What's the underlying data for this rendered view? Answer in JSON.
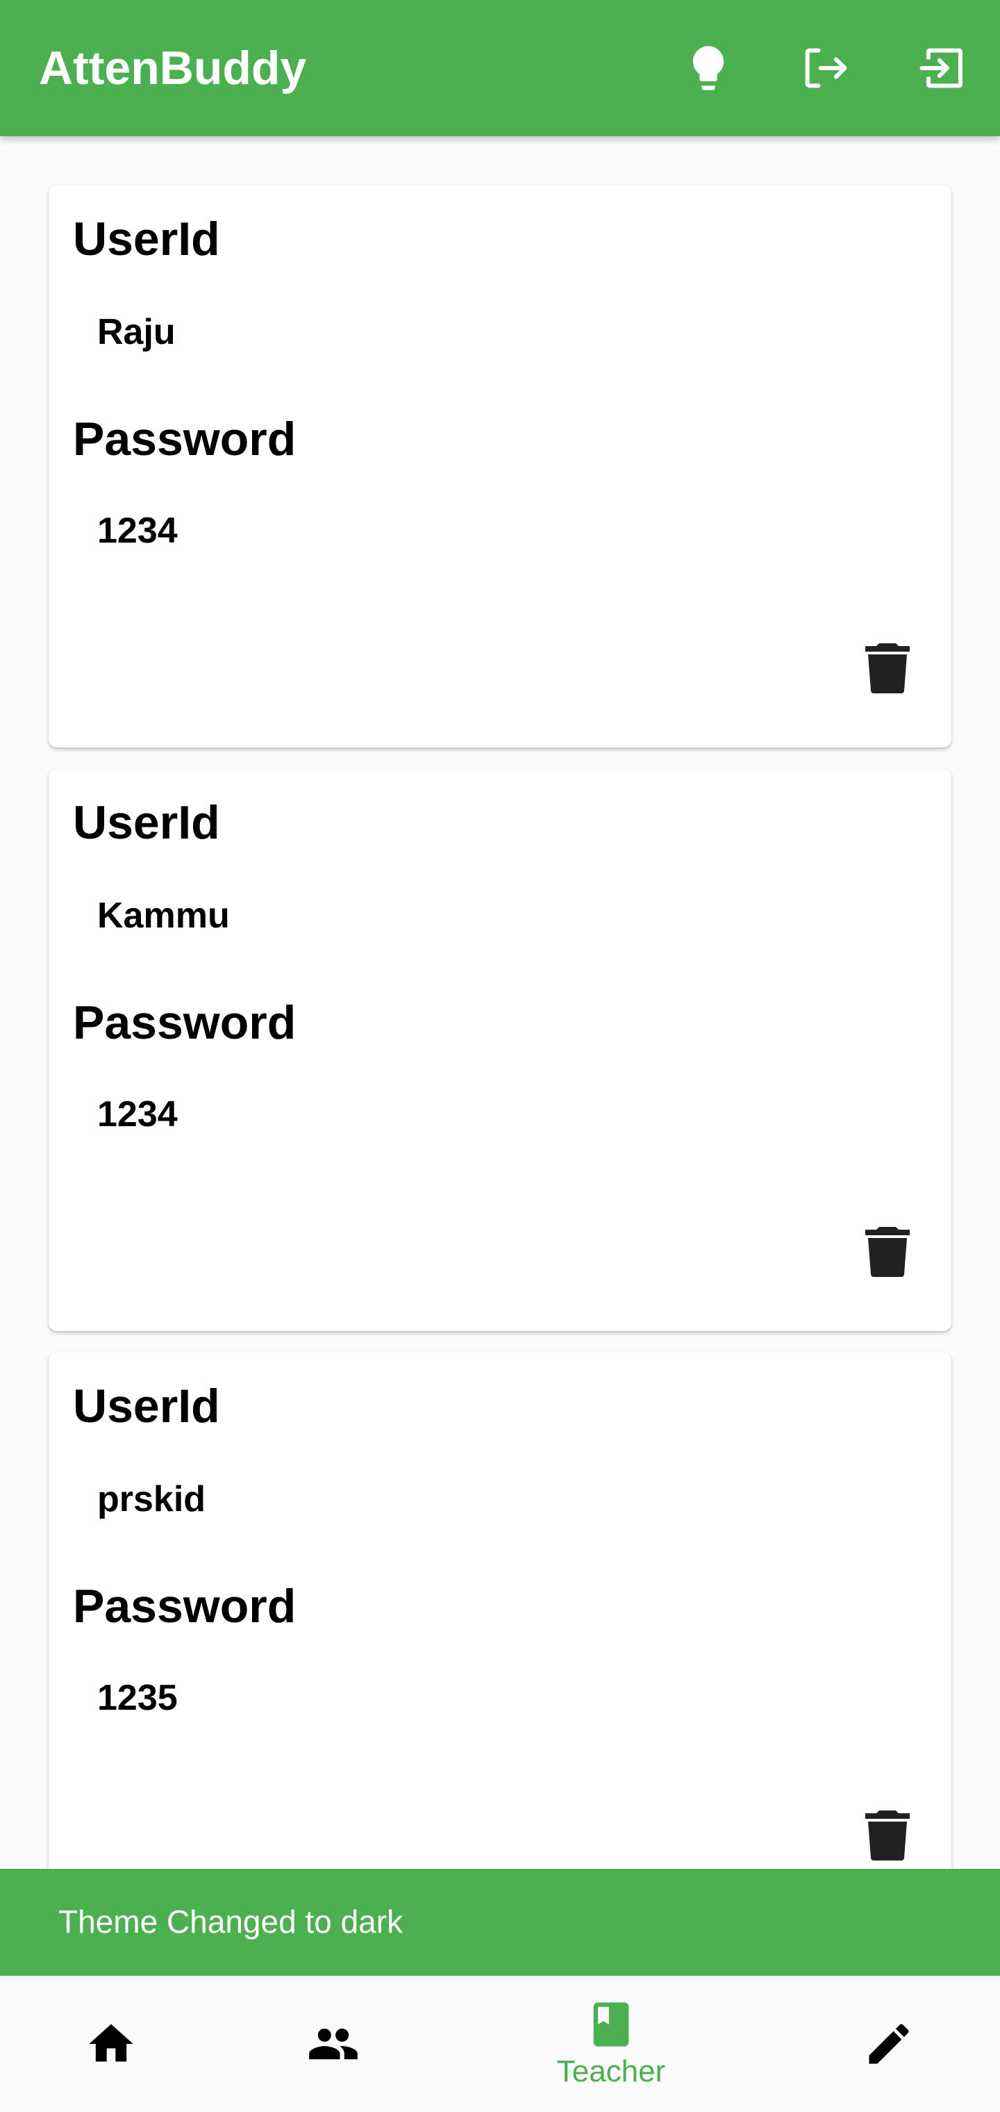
{
  "app": {
    "title": "AttenBuddy",
    "accent_color": "#4caf50",
    "actions": [
      {
        "name": "theme-toggle",
        "icon": "lightbulb-icon"
      },
      {
        "name": "logout",
        "icon": "logout-icon"
      },
      {
        "name": "login",
        "icon": "login-icon"
      }
    ]
  },
  "cards": [
    {
      "userid_label": "UserId",
      "userid": "Raju",
      "password_label": "Password",
      "password": "1234",
      "delete_icon": "trash-icon"
    },
    {
      "userid_label": "UserId",
      "userid": "Kammu",
      "password_label": "Password",
      "password": "1234",
      "delete_icon": "trash-icon"
    },
    {
      "userid_label": "UserId",
      "userid": "prskid",
      "password_label": "Password",
      "password": "1235",
      "delete_icon": "trash-icon"
    }
  ],
  "snackbar": {
    "message": "Theme Changed to dark"
  },
  "bottom_nav": {
    "items": [
      {
        "icon": "home-icon",
        "label": "",
        "selected": false
      },
      {
        "icon": "people-icon",
        "label": "",
        "selected": false
      },
      {
        "icon": "book-icon",
        "label": "Teacher",
        "selected": true
      },
      {
        "icon": "edit-icon",
        "label": "",
        "selected": false
      }
    ]
  }
}
